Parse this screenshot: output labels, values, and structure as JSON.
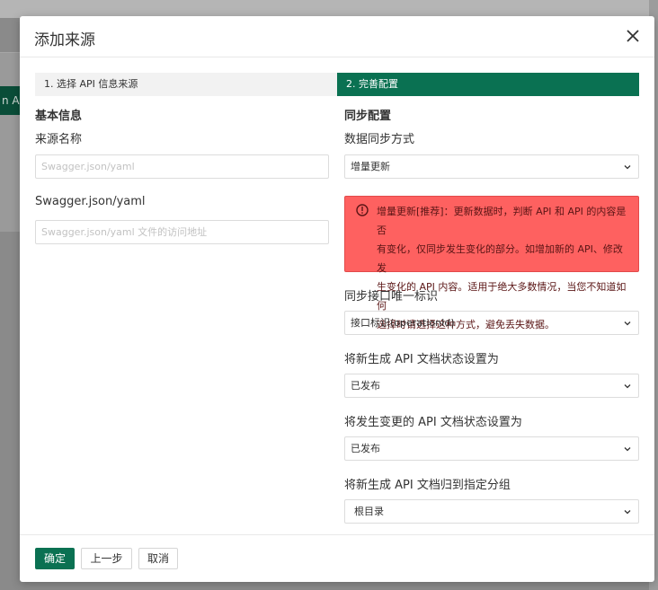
{
  "background": {
    "button_label": "n API"
  },
  "modal": {
    "title": "添加来源",
    "steps": [
      {
        "label": "1. 选择 API 信息来源"
      },
      {
        "label": "2. 完善配置"
      }
    ],
    "basic": {
      "section_title": "基本信息",
      "source_name_label": "来源名称",
      "source_name_placeholder": "Swagger.json/yaml",
      "swagger_label": "Swagger.json/yaml",
      "swagger_placeholder": "Swagger.json/yaml 文件的访问地址"
    },
    "sync": {
      "section_title": "同步配置",
      "method_label": "数据同步方式",
      "method_value": "增量更新",
      "alert_lines": [
        "增量更新[推荐]：更新数据时，判断 API 和 API 的内容是否",
        "有变化，仅同步发生变化的部分。如增加新的 API、修改发",
        "生变化的 API 内容。适用于绝大多数情况，当您不知道如何",
        "选择时请选择这种方式，避免丢失数据。"
      ],
      "unique_id_label": "同步接口唯一标识",
      "unique_id_value": "接口标识(operationId)",
      "new_status_label": "将新生成 API 文档状态设置为",
      "new_status_value": "已发布",
      "changed_status_label": "将发生变更的 API 文档状态设置为",
      "changed_status_value": "已发布",
      "group_label": "将新生成 API 文档归到指定分组",
      "group_value": "根目录"
    },
    "footer": {
      "confirm": "确定",
      "prev": "上一步",
      "cancel": "取消"
    }
  },
  "colors": {
    "primary": "#0a7152",
    "alert_bg": "#fe6160"
  }
}
